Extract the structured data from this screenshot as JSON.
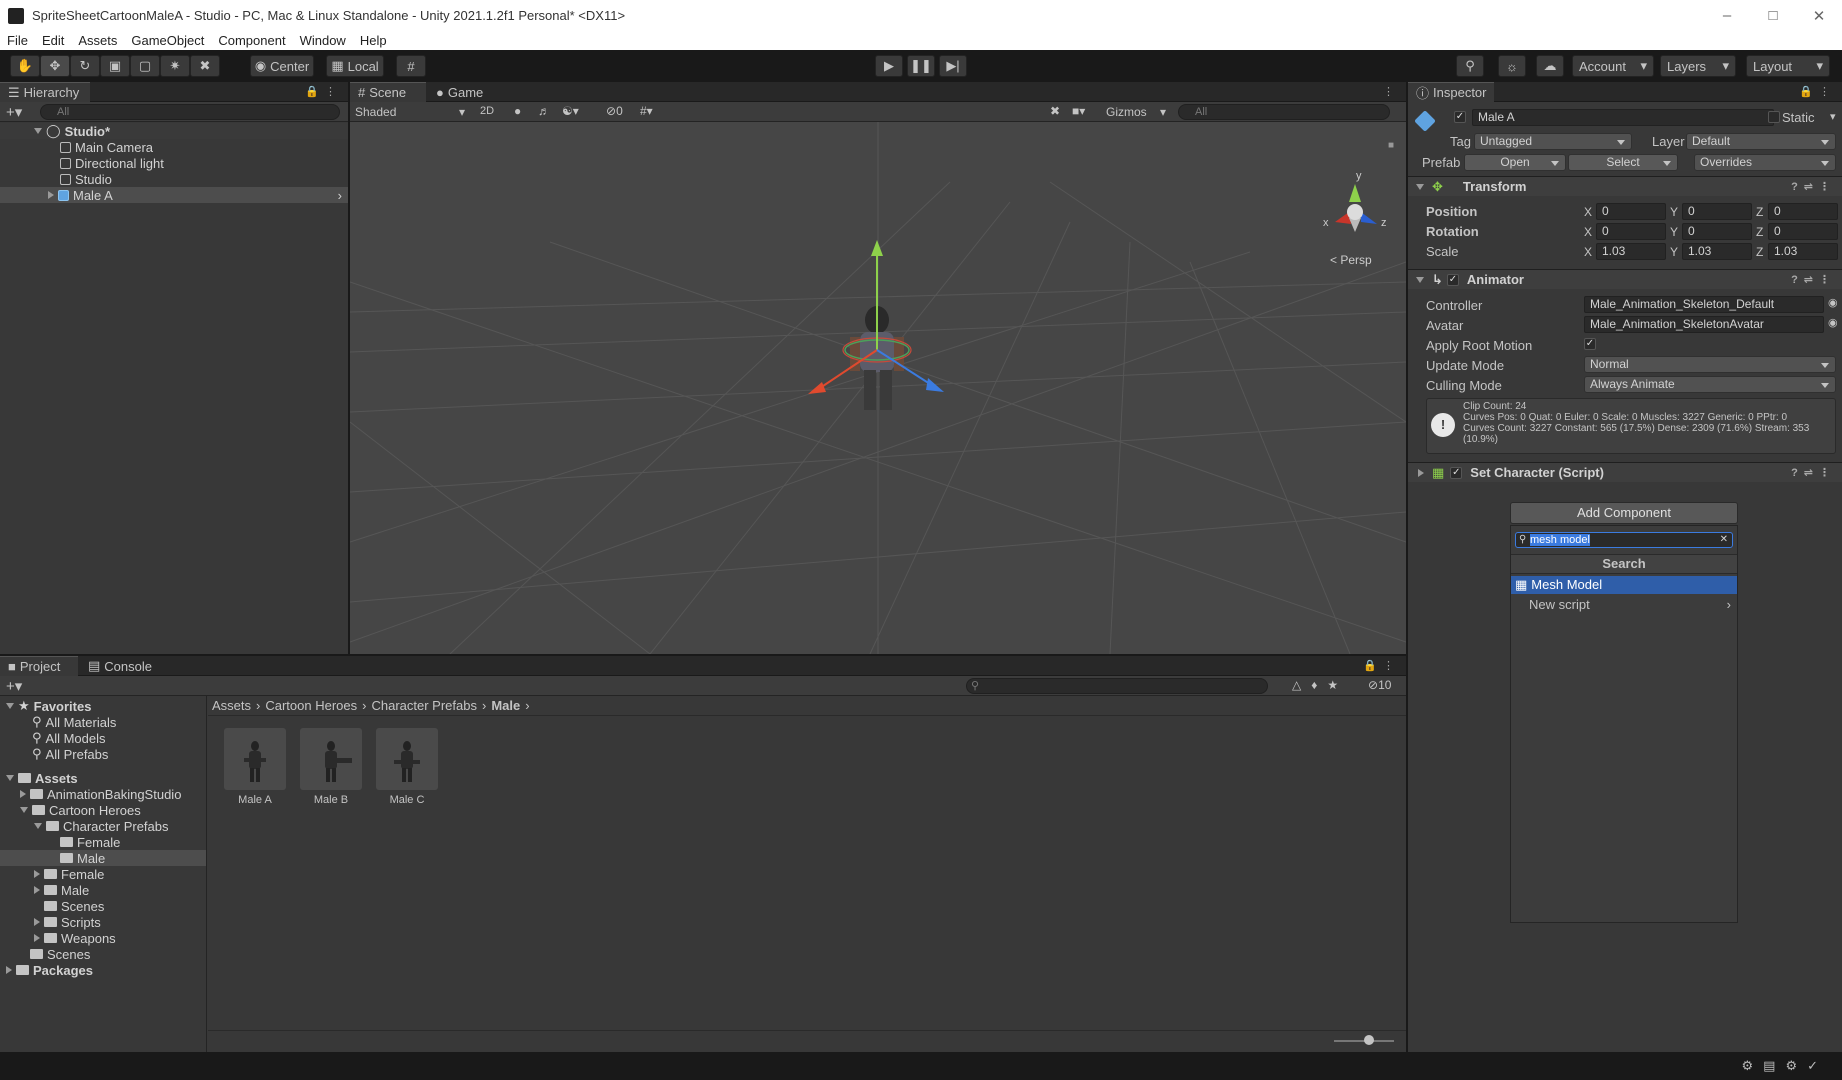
{
  "window": {
    "title": "SpriteSheetCartoonMaleA - Studio - PC, Mac & Linux Standalone - Unity 2021.1.2f1 Personal* <DX11>"
  },
  "menu": [
    "File",
    "Edit",
    "Assets",
    "GameObject",
    "Component",
    "Window",
    "Help"
  ],
  "toolbar": {
    "center": "Center",
    "local": "Local",
    "account": "Account",
    "layers": "Layers",
    "layout": "Layout"
  },
  "hierarchy": {
    "tab": "Hierarchy",
    "search_placeholder": "All",
    "scene": "Studio*",
    "items": [
      "Main Camera",
      "Directional light",
      "Studio",
      "Male A"
    ]
  },
  "scene_view": {
    "tab_scene": "Scene",
    "tab_game": "Game",
    "shading": "Shaded",
    "mode2d": "2D",
    "hidden_count": "0",
    "gizmos": "Gizmos",
    "search_placeholder": "All",
    "persp": "Persp",
    "gizmo_axes": {
      "x": "x",
      "y": "y",
      "z": "z"
    }
  },
  "inspector": {
    "tab": "Inspector",
    "object_name": "Male A",
    "static": "Static",
    "tag_label": "Tag",
    "tag_value": "Untagged",
    "layer_label": "Layer",
    "layer_value": "Default",
    "prefab_label": "Prefab",
    "open": "Open",
    "select": "Select",
    "overrides": "Overrides",
    "transform": {
      "title": "Transform",
      "position": "Position",
      "rotation": "Rotation",
      "scale": "Scale",
      "pos": [
        "0",
        "0",
        "0"
      ],
      "rot": [
        "0",
        "0",
        "0"
      ],
      "scl": [
        "1.03",
        "1.03",
        "1.03"
      ],
      "x": "X",
      "y": "Y",
      "z": "Z"
    },
    "animator": {
      "title": "Animator",
      "controller_label": "Controller",
      "controller_value": "Male_Animation_Skeleton_Default",
      "avatar_label": "Avatar",
      "avatar_value": "Male_Animation_SkeletonAvatar",
      "root_motion_label": "Apply Root Motion",
      "update_mode_label": "Update Mode",
      "update_mode_value": "Normal",
      "culling_label": "Culling Mode",
      "culling_value": "Always Animate",
      "info_line1": "Clip Count: 24",
      "info_line2": "Curves Pos: 0 Quat: 0 Euler: 0 Scale: 0 Muscles: 3227 Generic: 0 PPtr: 0",
      "info_line3": "Curves Count: 3227 Constant: 565 (17.5%) Dense: 2309 (71.6%) Stream: 353",
      "info_line4": "(10.9%)"
    },
    "script": {
      "title": "Set Character (Script)"
    },
    "add_component": "Add Component",
    "ac_search_value": "mesh model",
    "ac_search_header": "Search",
    "ac_results": [
      "Mesh Model",
      "New script"
    ]
  },
  "project": {
    "tab_project": "Project",
    "tab_console": "Console",
    "hidden_count": "10",
    "favorites_label": "Favorites",
    "favorites": [
      "All Materials",
      "All Models",
      "All Prefabs"
    ],
    "assets_label": "Assets",
    "tree": [
      "AnimationBakingStudio",
      "Cartoon Heroes",
      "Character Prefabs",
      "Female",
      "Male",
      "Female",
      "Male",
      "Scenes",
      "Scripts",
      "Weapons",
      "Scenes"
    ],
    "packages_label": "Packages",
    "breadcrumb": [
      "Assets",
      "Cartoon Heroes",
      "Character Prefabs",
      "Male"
    ],
    "assets": [
      "Male A",
      "Male B",
      "Male C"
    ]
  }
}
